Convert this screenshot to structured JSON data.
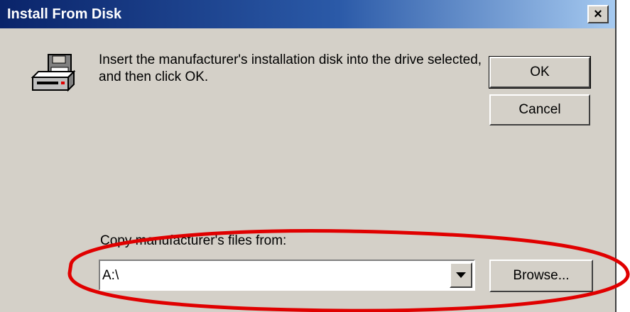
{
  "window": {
    "title": "Install From Disk",
    "close_label": "×"
  },
  "message": "Insert the manufacturer's installation disk into the drive selected, and then click OK.",
  "buttons": {
    "ok": "OK",
    "cancel": "Cancel",
    "browse": "Browse..."
  },
  "copy_from": {
    "label": "Copy manufacturer's files from:",
    "value": "A:\\"
  },
  "icons": {
    "disk": "floppy-drive-icon",
    "dropdown": "chevron-down-icon"
  },
  "colors": {
    "title_bar_start": "#0a246a",
    "title_bar_end": "#a6caf0",
    "dialog_bg": "#d4d0c8",
    "annotation": "#e00000"
  }
}
